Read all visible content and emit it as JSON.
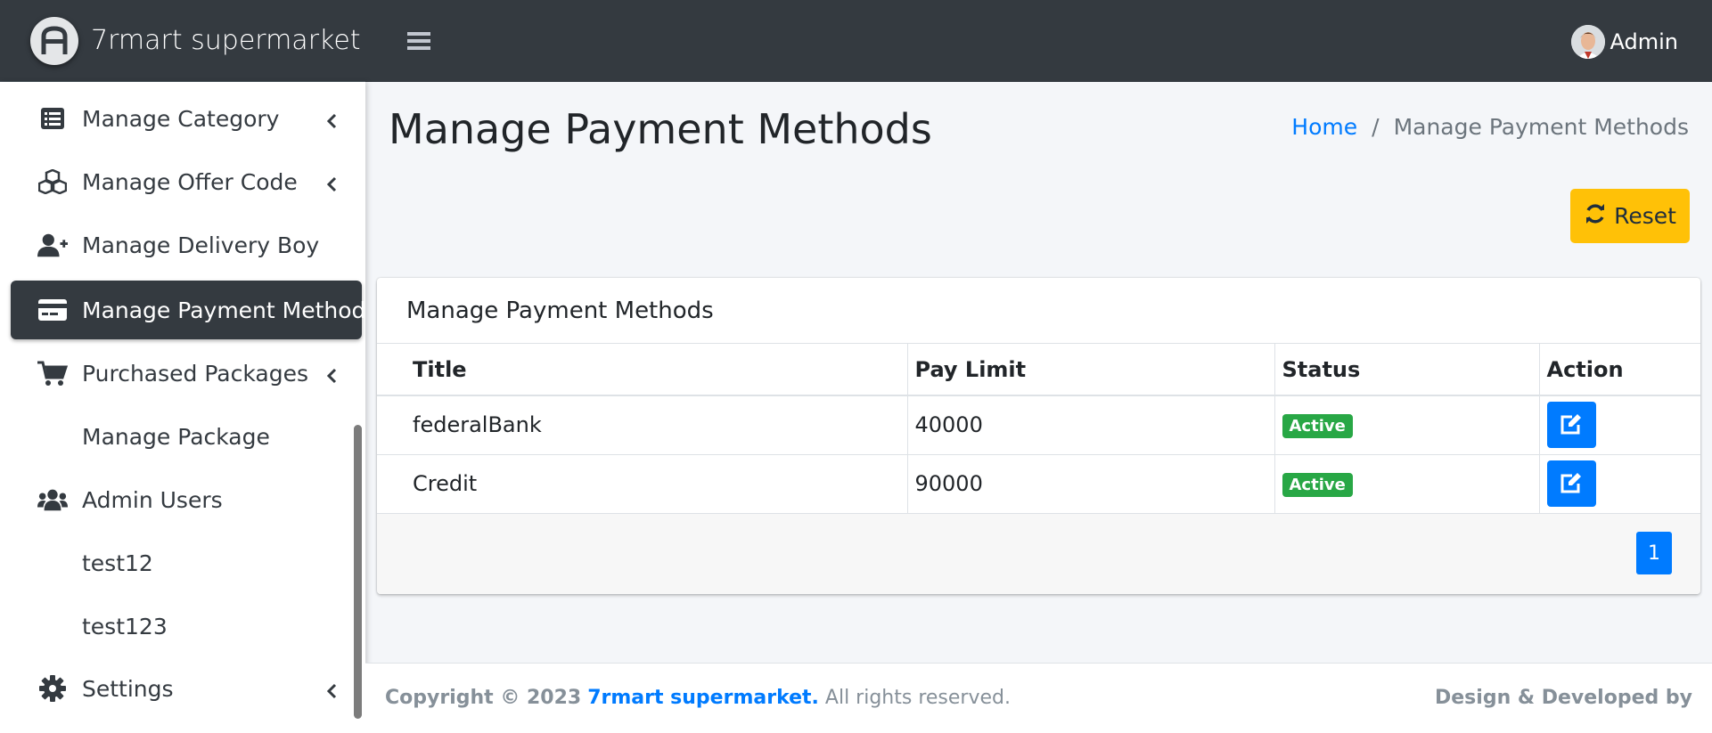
{
  "brand": {
    "name": "7rmart supermarket",
    "logo_icon": "brand-logo-icon"
  },
  "header": {
    "user_name": "Admin"
  },
  "sidebar": {
    "items": [
      {
        "label": "Manage Category",
        "icon": "list-icon",
        "has_children": true
      },
      {
        "label": "Manage Offer Code",
        "icon": "cubes-icon",
        "has_children": true
      },
      {
        "label": "Manage Delivery Boy",
        "icon": "user-plus-icon",
        "has_children": false
      },
      {
        "label": "Manage Payment Methods",
        "icon": "credit-card-icon",
        "has_children": false,
        "active": true
      },
      {
        "label": "Purchased Packages",
        "icon": "cart-icon",
        "has_children": true
      },
      {
        "label": "Manage Package",
        "icon": "",
        "has_children": false
      },
      {
        "label": "Admin Users",
        "icon": "users-icon",
        "has_children": false
      },
      {
        "label": "test12",
        "icon": "",
        "has_children": false
      },
      {
        "label": "test123",
        "icon": "",
        "has_children": false
      },
      {
        "label": "Settings",
        "icon": "gear-icon",
        "has_children": true
      }
    ]
  },
  "main": {
    "title": "Manage Payment Methods",
    "breadcrumb": {
      "home": "Home",
      "separator": "/",
      "current": "Manage Payment Methods"
    },
    "reset_label": "Reset",
    "card": {
      "title": "Manage Payment Methods",
      "columns": [
        "Title",
        "Pay Limit",
        "Status",
        "Action"
      ],
      "rows": [
        {
          "title": "federalBank",
          "pay_limit": "40000",
          "status": "Active"
        },
        {
          "title": "Credit",
          "pay_limit": "90000",
          "status": "Active"
        }
      ],
      "pagination": {
        "current": "1"
      }
    }
  },
  "footer": {
    "copyright_prefix": "Copyright © 2023",
    "brand_link": "7rmart supermarket.",
    "rights": "All rights reserved.",
    "right_text": "Design & Developed by"
  },
  "colors": {
    "dark": "#343a40",
    "accent": "#007bff",
    "warning": "#ffc107",
    "success": "#28a745"
  }
}
